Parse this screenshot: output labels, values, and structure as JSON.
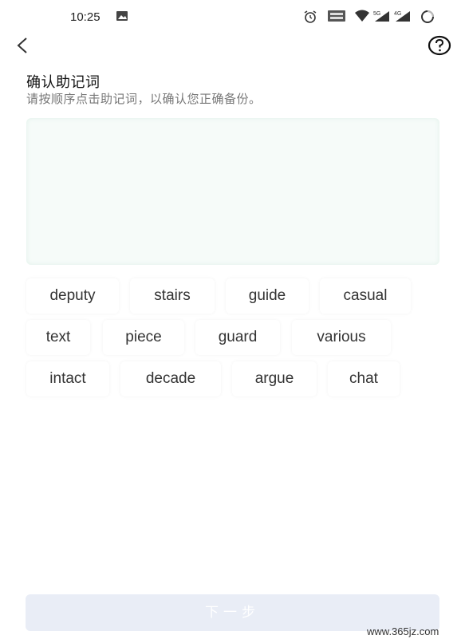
{
  "status_bar": {
    "time": "10:25",
    "icons": [
      "image-icon",
      "alarm-icon",
      "volte-icon",
      "wifi-icon",
      "signal-5g-icon",
      "signal-4g-icon",
      "battery-icon"
    ],
    "signal_labels": [
      "5G",
      "4G"
    ]
  },
  "header": {
    "back_icon": "chevron-left-icon",
    "help_icon": "help-circle-icon"
  },
  "main": {
    "title": "确认助记词",
    "subtitle": "请按顺序点击助记词，以确认您正确备份。"
  },
  "words": [
    {
      "label": "deputy"
    },
    {
      "label": "stairs"
    },
    {
      "label": "guide"
    },
    {
      "label": "casual"
    },
    {
      "label": "text"
    },
    {
      "label": "piece"
    },
    {
      "label": "guard"
    },
    {
      "label": "various"
    },
    {
      "label": "intact"
    },
    {
      "label": "decade"
    },
    {
      "label": "argue"
    },
    {
      "label": "chat"
    }
  ],
  "footer": {
    "next_label": "下一步"
  },
  "watermark": "www.365jz.com",
  "colors": {
    "answer_area_bg": "#f6fbf9",
    "button_disabled_bg": "#e9edf6",
    "chip_bg": "#ffffff"
  }
}
